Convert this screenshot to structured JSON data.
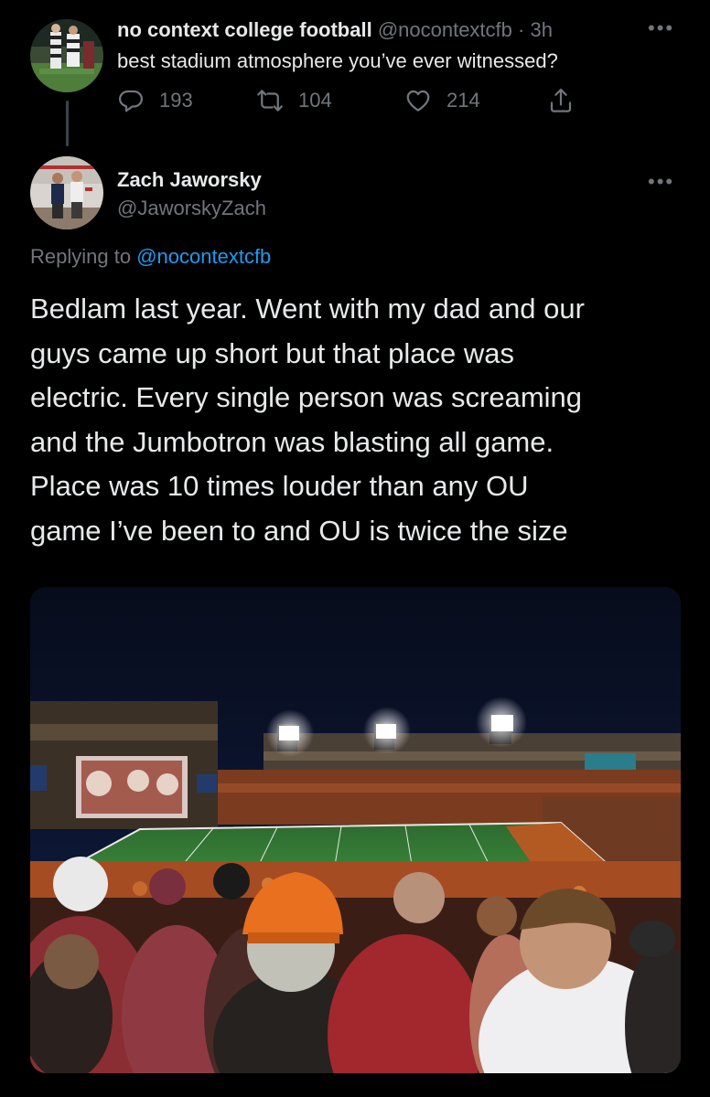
{
  "parent_tweet": {
    "author_name": "no context college football",
    "handle": "@nocontextcfb",
    "separator": "·",
    "time": "3h",
    "text": "best stadium atmosphere you’ve ever witnessed?",
    "more_icon": "ellipsis-icon",
    "actions": {
      "replies": "193",
      "retweets": "104",
      "likes": "214"
    }
  },
  "main_tweet": {
    "author_name": "Zach Jaworsky",
    "handle": "@JaworskyZach",
    "replying_prefix": "Replying to",
    "replying_to": "@nocontextcfb",
    "text": "Bedlam last year. Went with my dad and our\nguys came up short but that place was\nelectric. Every single person was screaming\nand the Jumbotron was blasting all game.\nPlace was 10 times louder than any OU\ngame I’ve been to and OU is twice the size"
  },
  "colors": {
    "background": "#000000",
    "primary_text": "#e7e9ea",
    "secondary_text": "#71767b",
    "link": "#1d9bf0",
    "thread_line": "#38444d"
  }
}
